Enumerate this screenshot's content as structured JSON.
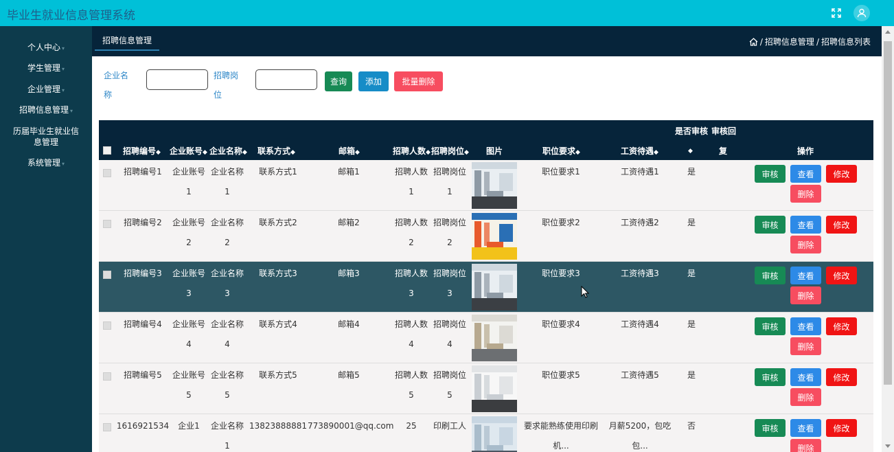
{
  "app": {
    "title": "毕业生就业信息管理系统"
  },
  "sidebar": {
    "items": [
      {
        "label": "个人中心",
        "caret": true
      },
      {
        "label": "学生管理",
        "caret": true
      },
      {
        "label": "企业管理",
        "caret": true
      },
      {
        "label": "招聘信息管理",
        "caret": true
      },
      {
        "label": "历届毕业生就业信息管理",
        "caret": false
      },
      {
        "label": "系统管理",
        "caret": true
      }
    ]
  },
  "subbar": {
    "tab": "招聘信息管理",
    "breadcrumb": [
      "招聘信息管理",
      "招聘信息列表"
    ],
    "sep": "/"
  },
  "search": {
    "company_label": "企业名称",
    "position_label": "招聘岗位",
    "company_value": "",
    "position_value": "",
    "query_button": "查询",
    "add_button": "添加",
    "batch_delete_button": "批量删除"
  },
  "table": {
    "columns": {
      "no": "招聘编号",
      "account": "企业账号",
      "company": "企业名称",
      "contact": "联系方式",
      "email": "邮箱",
      "count": "招聘人数",
      "position": "招聘岗位",
      "image": "图片",
      "requirement": "职位要求",
      "salary": "工资待遇",
      "audited_top": "是否审核",
      "reply_top": "审核回",
      "reply_bottom": "复",
      "actions": "操作"
    },
    "sort_glyph": "◆",
    "buttons": {
      "audit": "审核",
      "view": "查看",
      "edit": "修改",
      "delete": "删除"
    },
    "rows": [
      {
        "no": "招聘编号1",
        "acc1": "企业账号",
        "acc2": "1",
        "com1": "企业名称",
        "com2": "1",
        "contact": "联系方式1",
        "email": "邮箱1",
        "cnt1": "招聘人数",
        "cnt2": "1",
        "pos1": "招聘岗位",
        "pos2": "1",
        "req": "职位要求1",
        "req2": "",
        "sal": "工资待遇1",
        "sal2": "",
        "audited": "是",
        "reply": ""
      },
      {
        "no": "招聘编号2",
        "acc1": "企业账号",
        "acc2": "2",
        "com1": "企业名称",
        "com2": "2",
        "contact": "联系方式2",
        "email": "邮箱2",
        "cnt1": "招聘人数",
        "cnt2": "2",
        "pos1": "招聘岗位",
        "pos2": "2",
        "req": "职位要求2",
        "req2": "",
        "sal": "工资待遇2",
        "sal2": "",
        "audited": "是",
        "reply": ""
      },
      {
        "no": "招聘编号3",
        "acc1": "企业账号",
        "acc2": "3",
        "com1": "企业名称",
        "com2": "3",
        "contact": "联系方式3",
        "email": "邮箱3",
        "cnt1": "招聘人数",
        "cnt2": "3",
        "pos1": "招聘岗位",
        "pos2": "3",
        "req": "职位要求3",
        "req2": "",
        "sal": "工资待遇3",
        "sal2": "",
        "audited": "是",
        "reply": ""
      },
      {
        "no": "招聘编号4",
        "acc1": "企业账号",
        "acc2": "4",
        "com1": "企业名称",
        "com2": "4",
        "contact": "联系方式4",
        "email": "邮箱4",
        "cnt1": "招聘人数",
        "cnt2": "4",
        "pos1": "招聘岗位",
        "pos2": "4",
        "req": "职位要求4",
        "req2": "",
        "sal": "工资待遇4",
        "sal2": "",
        "audited": "是",
        "reply": ""
      },
      {
        "no": "招聘编号5",
        "acc1": "企业账号",
        "acc2": "5",
        "com1": "企业名称",
        "com2": "5",
        "contact": "联系方式5",
        "email": "邮箱5",
        "cnt1": "招聘人数",
        "cnt2": "5",
        "pos1": "招聘岗位",
        "pos2": "5",
        "req": "职位要求5",
        "req2": "",
        "sal": "工资待遇5",
        "sal2": "",
        "audited": "是",
        "reply": ""
      },
      {
        "no": "1616921534",
        "acc1": "企业1",
        "acc2": "",
        "com1": "企业名称",
        "com2": "1",
        "contact": "13823888881",
        "email": "773890001@qq.com",
        "cnt1": "25",
        "cnt2": "",
        "pos1": "印刷工人",
        "pos2": "",
        "req": "要求能熟练使用印刷",
        "req2": "机...",
        "sal": "月薪5200，包吃",
        "sal2": "包...",
        "audited": "否",
        "reply": ""
      }
    ]
  }
}
